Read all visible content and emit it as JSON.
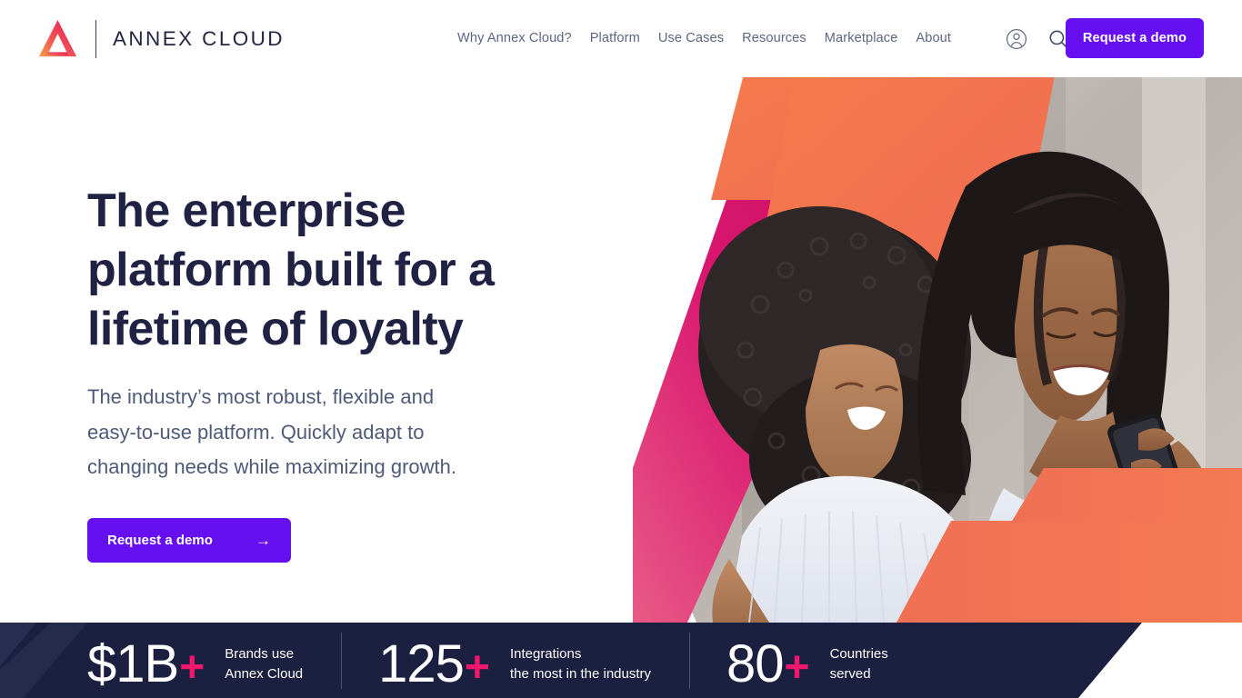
{
  "brand": {
    "logo_icon": "annex-cloud-triangle-logo",
    "name": "ANNEX CLOUD",
    "logo_gradient_from": "#e8195f",
    "logo_gradient_to": "#f47b3f"
  },
  "header": {
    "nav": [
      {
        "label": "Why Annex Cloud?"
      },
      {
        "label": "Platform"
      },
      {
        "label": "Use Cases"
      },
      {
        "label": "Resources"
      },
      {
        "label": "Marketplace"
      },
      {
        "label": "About"
      }
    ],
    "account_icon": "user-account-icon",
    "search_icon": "search-icon",
    "cta_label": "Request a demo",
    "cta_color": "#6610f2"
  },
  "hero": {
    "title_line_1": "The enterprise",
    "title_line_2": "platform built for a",
    "title_line_3": "lifetime of loyalty",
    "subtitle_line_1": "The industry’s most robust, flexible and",
    "subtitle_line_2": "easy-to-use platform. Quickly adapt to",
    "subtitle_line_3": "changing needs while maximizing growth.",
    "cta_label": "Request a demo",
    "cta_arrow": "→",
    "image_alt": "two smiling women looking at a smartphone",
    "accent_magenta": "#d9156f",
    "accent_orange": "#f47b4d",
    "title_color": "#1f2243",
    "subtitle_color": "#4e5a78"
  },
  "stats": {
    "background_color": "#1c2040",
    "plus_color": "#f0186d",
    "items": [
      {
        "value": "$1B",
        "plus": "+",
        "label_line_1": "Brands use",
        "label_line_2": "Annex Cloud"
      },
      {
        "value": "125",
        "plus": "+",
        "label_line_1": "Integrations",
        "label_line_2": "the most in the industry"
      },
      {
        "value": "80",
        "plus": "+",
        "label_line_1": "Countries",
        "label_line_2": "served"
      }
    ]
  }
}
